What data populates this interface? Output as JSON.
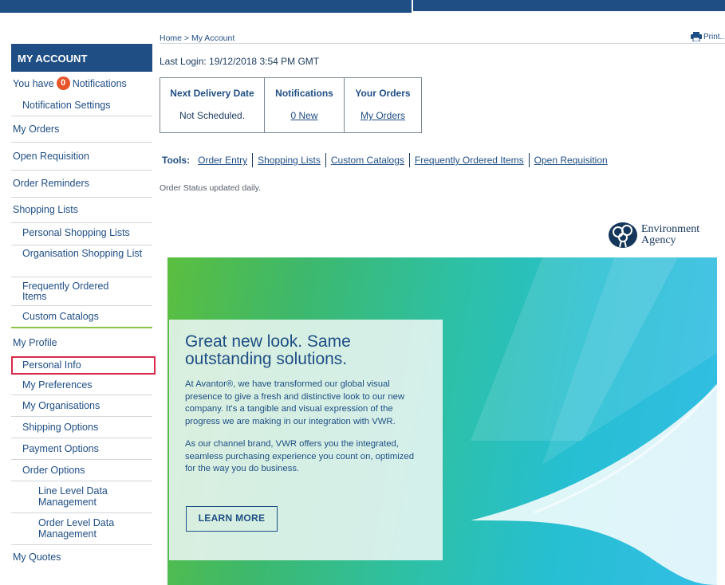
{
  "breadcrumb": "Home > My Account",
  "print_label": "Print..",
  "last_login": "Last Login: 19/12/2018 3:54 PM GMT",
  "sidebar": {
    "header": "MY ACCOUNT",
    "notifications": {
      "prefix": "You have",
      "count": "0",
      "suffix": "Notifications"
    },
    "items": [
      "Notification Settings",
      "My Orders",
      "Open Requisition",
      "Order Reminders",
      "Shopping Lists",
      "Personal Shopping Lists",
      "Organisation Shopping List",
      "Frequently Ordered Items",
      "Custom Catalogs",
      "My Profile",
      "Personal Info",
      "My Preferences",
      "My Organisations",
      "Shipping Options",
      "Payment Options",
      "Order Options",
      "Line Level Data Management",
      "Order Level Data Management",
      "My Quotes"
    ],
    "highlighted_item": "Personal Info"
  },
  "summary": {
    "columns": [
      {
        "header": "Next Delivery Date",
        "value": "Not Scheduled."
      },
      {
        "header": "Notifications",
        "value": "0 New"
      },
      {
        "header": "Your Orders",
        "value": "My Orders"
      }
    ]
  },
  "tools": {
    "label": "Tools:",
    "links": [
      "Order Entry",
      "Shopping Lists",
      "Custom Catalogs",
      "Frequently Ordered Items",
      "Open Requisition"
    ]
  },
  "status_note": "Order Status updated daily.",
  "agency": {
    "line1": "Environment",
    "line2": "Agency"
  },
  "banner": {
    "title": "Great new look. Same outstanding solutions.",
    "paragraph1": "At Avantor®, we have transformed our global visual presence to give a fresh and distinctive look to our new company. It's a tangible and visual expression of the progress we are making in our integration with VWR.",
    "paragraph2": "As our channel brand, VWR offers you the integrated, seamless purchasing experience you count on, optimized for the way you do business.",
    "button": "LEARN MORE"
  },
  "colors": {
    "brand_navy": "#1f4e84",
    "badge": "#e8552b",
    "highlight": "#d62c4a",
    "separator": "#8bc34a"
  }
}
